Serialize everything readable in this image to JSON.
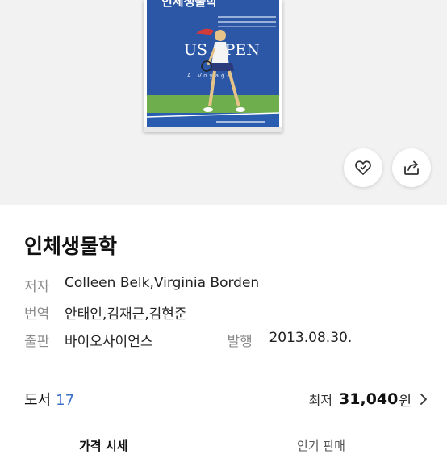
{
  "book": {
    "title": "인체생물학",
    "cover_title": "인체생물학",
    "cover_text": "US OPEN",
    "cover_sub": "A Voyage"
  },
  "meta": {
    "author_label": "저자",
    "author_value": "Colleen Belk,Virginia Borden",
    "translator_label": "번역",
    "translator_value": "안태인,김재근,김현준",
    "publisher_label": "출판",
    "publisher_value": "바이오사이언스",
    "pubdate_label": "발행",
    "pubdate_value": "2013.08.30."
  },
  "footer": {
    "category_label": "도서",
    "category_count": "17",
    "price_label": "최저",
    "price_value": "31,040",
    "price_unit": "원"
  },
  "tabs": [
    {
      "label": "가격 시세"
    },
    {
      "label": "인기 판매"
    }
  ],
  "icons": {
    "like": "heart-icon",
    "share": "share-icon",
    "chevron": "chevron-right-icon"
  }
}
